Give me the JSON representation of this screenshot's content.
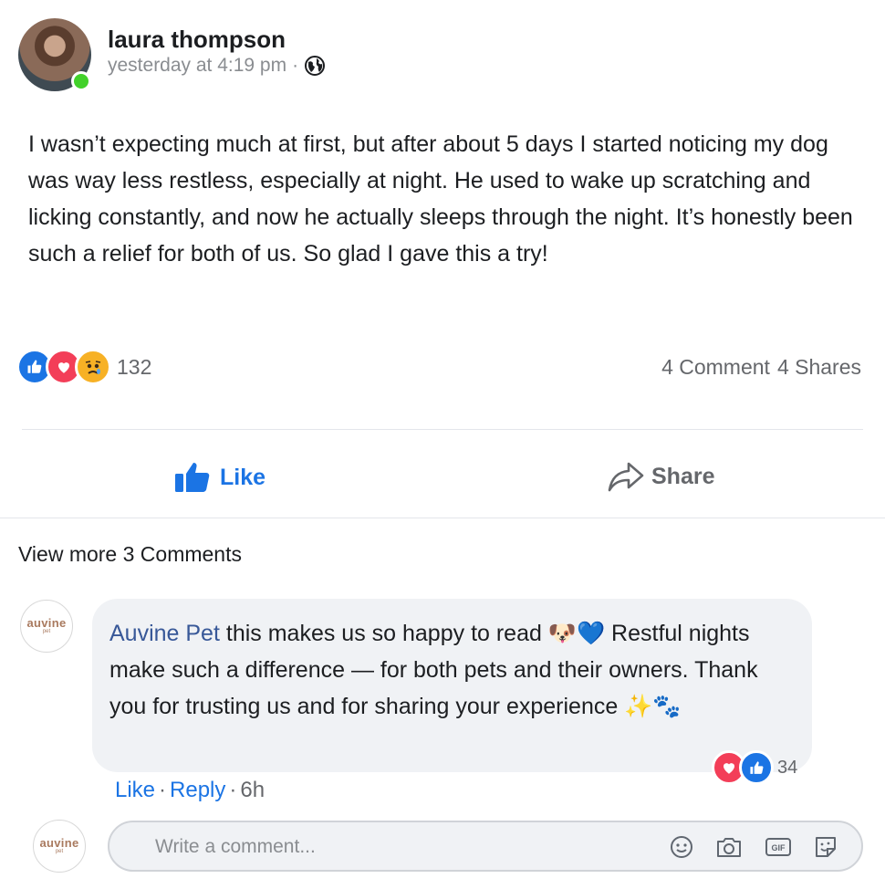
{
  "post": {
    "author": "laura thompson",
    "timestamp": "yesterday at 4:19 pm",
    "separator": "·",
    "privacy_icon": "globe-icon",
    "text": "I wasn’t expecting much at first, but after about 5 days I started noticing my dog was way less restless, especially at night. He used to wake up scratching and licking constantly, and now he actually sleeps through the night. It’s honestly been such a relief for both of us. So glad I gave this a try!",
    "reactions": {
      "icons": [
        "like-icon",
        "love-icon",
        "sad-icon"
      ],
      "count": "132"
    },
    "comments_label": "4 Comment",
    "shares_label": "4 Shares"
  },
  "actions": {
    "like_label": "Like",
    "share_label": "Share"
  },
  "comments_section": {
    "view_more_label": "View more 3 Comments",
    "comment": {
      "avatar_brand": "auvine",
      "avatar_sub": "pet",
      "author": "Auvine Pet",
      "text": "this makes us so happy to read 🐶💙 Restful nights make such a difference — for both pets and their owners. Thank you for trusting us and for sharing your experience ✨🐾",
      "reactions": {
        "icons": [
          "love-icon",
          "like-icon"
        ],
        "count": "34"
      },
      "like_label": "Like",
      "reply_label": "Reply",
      "separator": "·",
      "time": "6h"
    },
    "composer": {
      "avatar_brand": "auvine",
      "avatar_sub": "pet",
      "placeholder": "Write a comment...",
      "tools": [
        "emoji-icon",
        "camera-icon",
        "gif-icon",
        "sticker-icon"
      ]
    }
  },
  "colors": {
    "accent": "#1b74e4",
    "author_link": "#385898",
    "muted": "#65676b",
    "online": "#42d12a"
  }
}
